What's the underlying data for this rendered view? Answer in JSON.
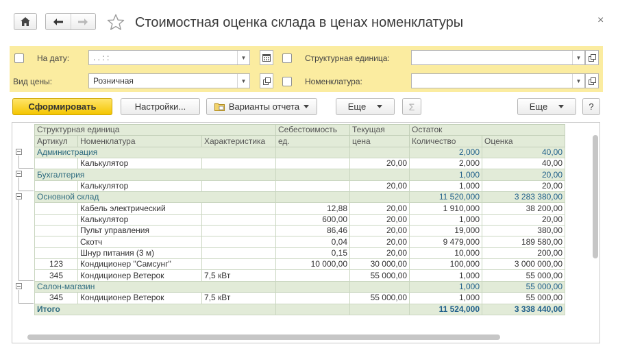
{
  "window": {
    "title": "Стоимостная оценка склада в ценах номенклатуры",
    "close_glyph": "×"
  },
  "filters": {
    "date_label": "На дату:",
    "date_value": " .  .       :  :",
    "price_type_label": "Вид цены:",
    "price_type_value": "Розничная",
    "struct_unit_label": "Структурная единица:",
    "struct_unit_value": "",
    "nomenclature_label": "Номенклатура:",
    "nomenclature_value": ""
  },
  "toolbar": {
    "generate_label": "Сформировать",
    "settings_label": "Настройки...",
    "variants_label": "Варианты отчета",
    "more1_label": "Еще",
    "more2_label": "Еще",
    "help_label": "?",
    "sum_glyph": "Σ"
  },
  "report": {
    "header1": {
      "struct_unit": "Структурная единица",
      "cost": "Себестоимость",
      "current": "Текущая",
      "remainder": "Остаток"
    },
    "header2": {
      "article": "Артикул",
      "nomenclature": "Номенклатура",
      "characteristic": "Характеристика",
      "cost_unit": "ед.",
      "price": "цена",
      "qty": "Количество",
      "valuation": "Оценка"
    },
    "rows": [
      {
        "type": "grp",
        "name": "Администрация",
        "qty": "2,000",
        "val": "40,00"
      },
      {
        "type": "item",
        "art": "",
        "name": "Калькулятор",
        "ch": "",
        "cost": "",
        "price": "20,00",
        "qty": "2,000",
        "val": "40,00"
      },
      {
        "type": "grp",
        "name": "Бухгалтерия",
        "qty": "1,000",
        "val": "20,00"
      },
      {
        "type": "item",
        "art": "",
        "name": "Калькулятор",
        "ch": "",
        "cost": "",
        "price": "20,00",
        "qty": "1,000",
        "val": "20,00"
      },
      {
        "type": "grp",
        "name": "Основной склад",
        "qty": "11 520,000",
        "val": "3 283 380,00"
      },
      {
        "type": "item",
        "art": "",
        "name": "Кабель электрический",
        "ch": "",
        "cost": "12,88",
        "price": "20,00",
        "qty": "1 910,000",
        "val": "38 200,00"
      },
      {
        "type": "item",
        "art": "",
        "name": "Калькулятор",
        "ch": "",
        "cost": "600,00",
        "price": "20,00",
        "qty": "1,000",
        "val": "20,00"
      },
      {
        "type": "item",
        "art": "",
        "name": "Пульт управления",
        "ch": "",
        "cost": "86,46",
        "price": "20,00",
        "qty": "19,000",
        "val": "380,00"
      },
      {
        "type": "item",
        "art": "",
        "name": "Скотч",
        "ch": "",
        "cost": "0,04",
        "price": "20,00",
        "qty": "9 479,000",
        "val": "189 580,00"
      },
      {
        "type": "item",
        "art": "",
        "name": "Шнур питания (3 м)",
        "ch": "",
        "cost": "0,15",
        "price": "20,00",
        "qty": "10,000",
        "val": "200,00"
      },
      {
        "type": "item",
        "art": "123",
        "name": "Кондиционер \"Самсунг\"",
        "ch": "",
        "cost": "10 000,00",
        "price": "30 000,00",
        "qty": "100,000",
        "val": "3 000 000,00"
      },
      {
        "type": "item",
        "art": "345",
        "name": "Кондиционер Ветерок",
        "ch": "7,5 кВт",
        "cost": "",
        "price": "55 000,00",
        "qty": "1,000",
        "val": "55 000,00"
      },
      {
        "type": "grp",
        "name": "Салон-магазин",
        "qty": "1,000",
        "val": "55 000,00"
      },
      {
        "type": "item",
        "art": "345",
        "name": "Кондиционер Ветерок",
        "ch": "7,5 кВт",
        "cost": "",
        "price": "55 000,00",
        "qty": "1,000",
        "val": "55 000,00"
      },
      {
        "type": "total",
        "name": "Итого",
        "qty": "11 524,000",
        "val": "3 338 440,00"
      }
    ]
  }
}
